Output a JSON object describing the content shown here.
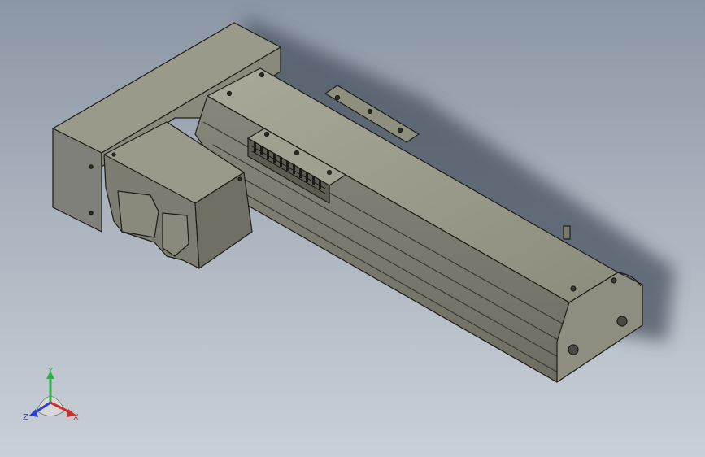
{
  "viewport": {
    "background_top": "#8b96a4",
    "background_bottom": "#c9d0d7"
  },
  "model": {
    "body_color": "#8f8f80",
    "shade_color": "#6a6a5c",
    "highlight_color": "#b8b8a8",
    "edge_color": "#1c1c18"
  },
  "triad": {
    "x_label": "X",
    "y_label": "Y",
    "z_label": "Z",
    "x_color": "#d42a2a",
    "y_color": "#2fb14a",
    "z_color": "#2a3fd4"
  }
}
